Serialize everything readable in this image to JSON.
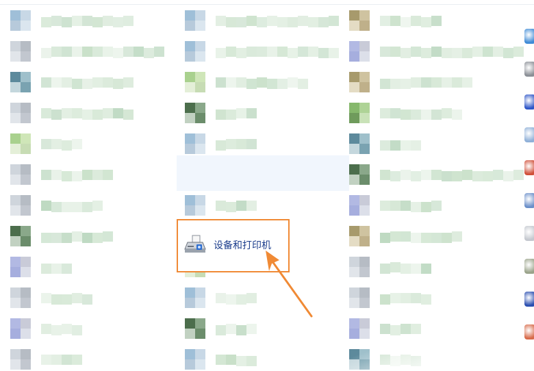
{
  "highlighted_item": {
    "label": "设备和打印机",
    "icon": "printer-icon"
  },
  "colors": {
    "callout_border": "#f08a35",
    "arrow": "#f08a35",
    "label_text": "#1c3d8c",
    "hover_background": "#f1f6fd"
  },
  "side_icons": [
    "globe-icon",
    "firewall-icon",
    "flag-icon",
    "gear-icon",
    "colors-icon",
    "calculator-icon",
    "disc-icon",
    "display-icon",
    "monitor-icon",
    "shield-icon"
  ]
}
